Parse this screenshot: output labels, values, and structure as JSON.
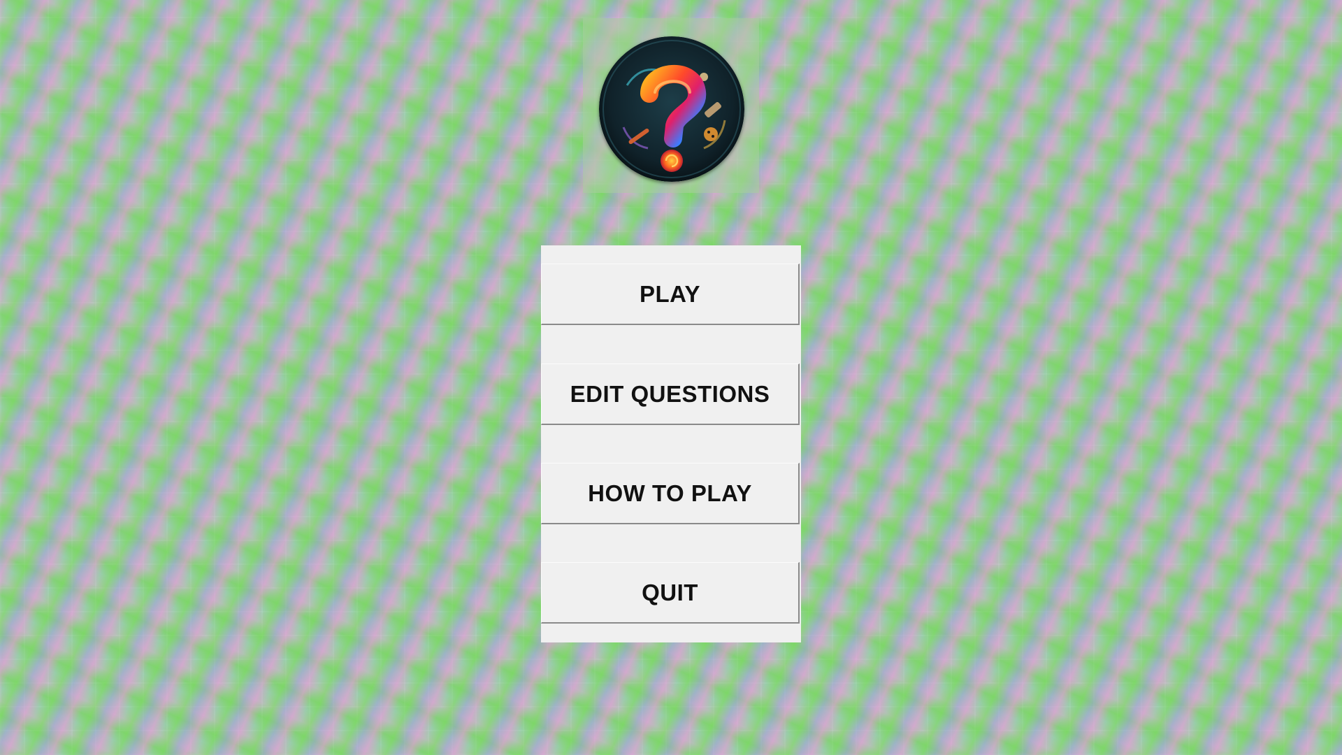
{
  "logo": {
    "icon": "question-mark-icon"
  },
  "menu": {
    "play_label": "PLAY",
    "edit_label": "EDIT QUESTIONS",
    "how_label": "HOW TO PLAY",
    "quit_label": "QUIT"
  }
}
